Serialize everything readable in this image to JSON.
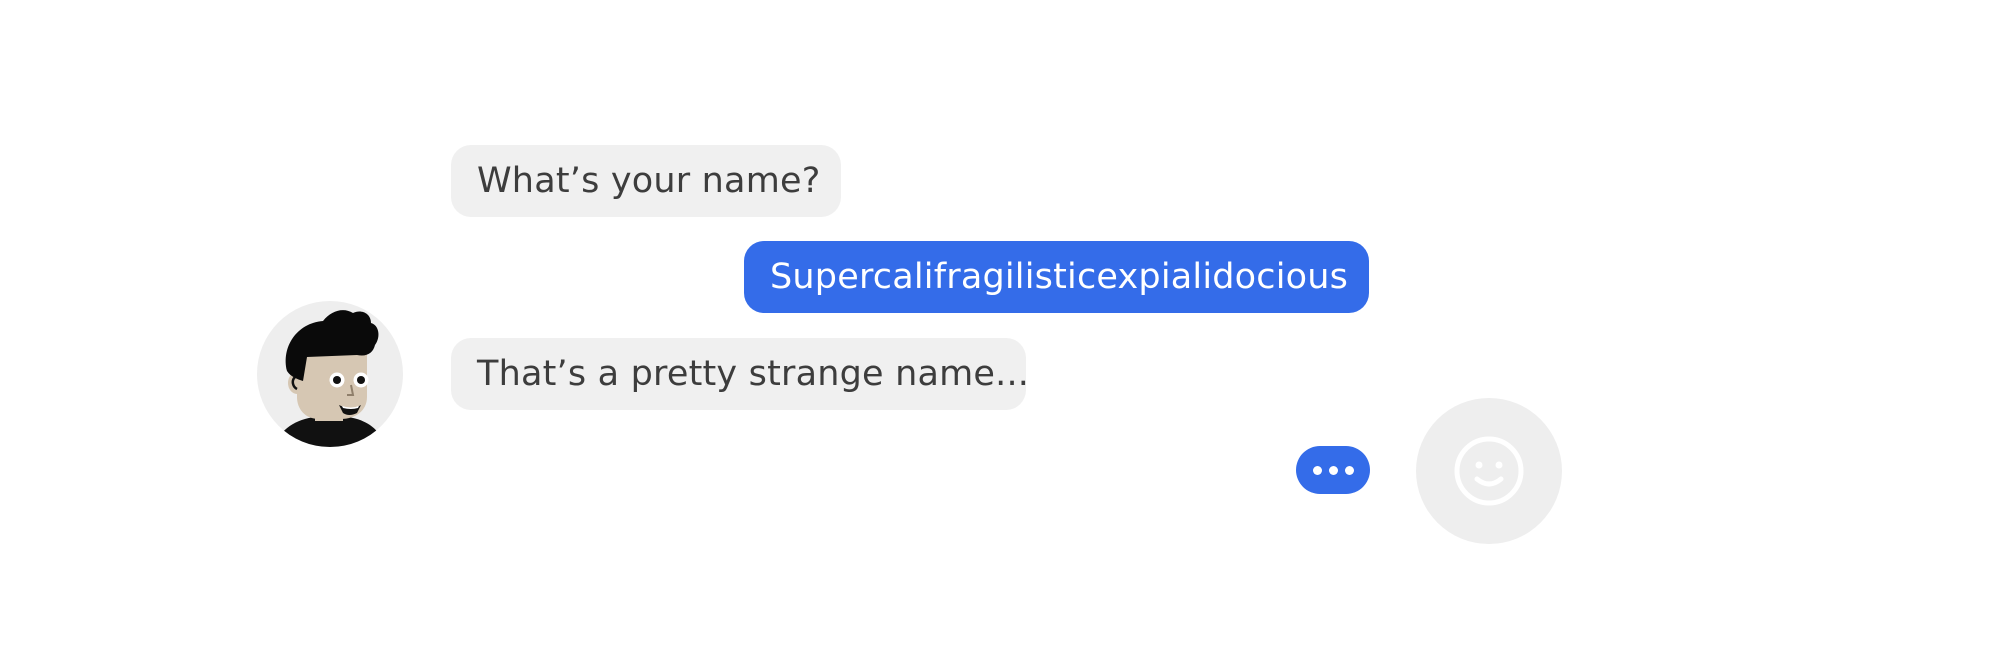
{
  "conversation": {
    "messages": [
      {
        "sender": "bot",
        "text": "What’s your name?"
      },
      {
        "sender": "user",
        "text": "Supercalifragilisticexpialidocious"
      },
      {
        "sender": "bot",
        "text": "That’s a pretty strange name..."
      }
    ]
  },
  "bot": {
    "avatar_icon": "cartoon-man-avatar-icon"
  },
  "user": {
    "avatar_icon": "smiley-face-icon",
    "typing_icon": "ellipsis-icon"
  },
  "colors": {
    "accent": "#346ce9",
    "bubble_incoming": "#f0f0f0",
    "text_incoming": "#3d3d3d",
    "avatar_bg": "#eeeeee"
  }
}
